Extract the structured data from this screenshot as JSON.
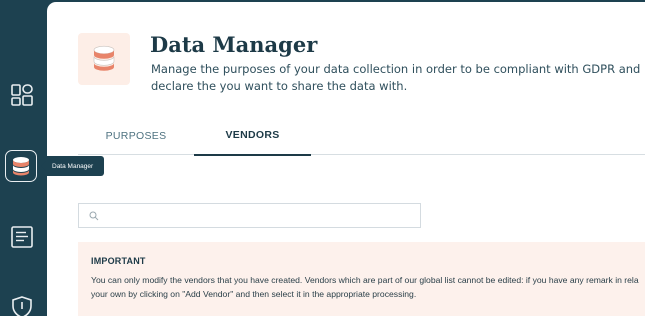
{
  "sidebar": {
    "items": [
      {
        "name": "dashboard",
        "icon": "layout-grid-icon"
      },
      {
        "name": "data-manager",
        "icon": "database-icon",
        "active": true
      },
      {
        "name": "documents",
        "icon": "document-list-icon"
      },
      {
        "name": "security",
        "icon": "shield-icon"
      }
    ],
    "tooltip": "Data Manager"
  },
  "header": {
    "icon": "database-icon",
    "title": "Data Manager",
    "subtitle": "Manage the purposes of your data collection in order to be compliant with GDPR and declare the you want to share the data with."
  },
  "tabs": [
    {
      "label": "PURPOSES",
      "active": false
    },
    {
      "label": "VENDORS",
      "active": true
    }
  ],
  "search": {
    "placeholder": "",
    "value": "",
    "icon": "search-icon"
  },
  "notice": {
    "title": "IMPORTANT",
    "line1": "You can only modify the vendors that you have created. Vendors which are part of our global list cannot be edited: if you have any remark in rela",
    "line2": "your own by clicking on \"Add Vendor\" and then select it in the appropriate processing."
  },
  "colors": {
    "sidebar": "#1d4150",
    "accent": "#1d3a47",
    "notice_bg": "#fdf1ec",
    "logo_bg": "#fdeee7",
    "logo_fill": "#e8846a"
  }
}
